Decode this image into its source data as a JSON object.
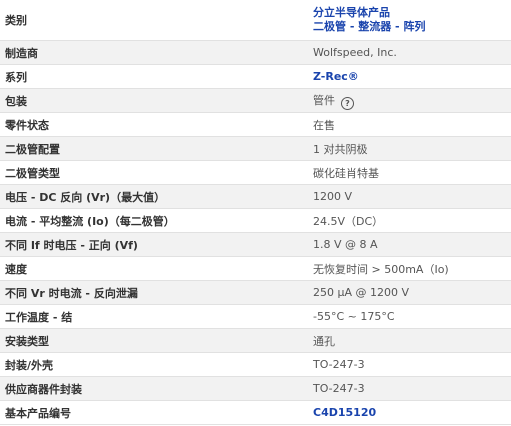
{
  "category": {
    "label": "类别",
    "link1": "分立半导体产品",
    "link2": "二极管 - 整流器 - 阵列"
  },
  "rows": [
    {
      "label": "制造商",
      "value": "Wolfspeed, Inc."
    },
    {
      "label": "系列",
      "value": "Z-Rec®"
    },
    {
      "label": "包装",
      "value": "管件"
    },
    {
      "label": "零件状态",
      "value": "在售"
    },
    {
      "label": "二极管配置",
      "value": "1 对共阴极"
    },
    {
      "label": "二极管类型",
      "value": "碳化硅肖特基"
    },
    {
      "label": "电压 - DC 反向 (Vr)（最大值）",
      "value": "1200 V"
    },
    {
      "label": "电流 - 平均整流 (Io)（每二极管）",
      "value": "24.5V（DC）"
    },
    {
      "label": "不同 If 时电压 - 正向 (Vf)",
      "value": "1.8 V @ 8 A"
    },
    {
      "label": "速度",
      "value": "无恢复时间 > 500mA（Io)"
    },
    {
      "label": "不同 Vr 时电流 - 反向泄漏",
      "value": "250 µA @ 1200 V"
    },
    {
      "label": "工作温度 - 结",
      "value": "-55°C ~ 175°C"
    },
    {
      "label": "安装类型",
      "value": "通孔"
    },
    {
      "label": "封装/外壳",
      "value": "TO-247-3"
    },
    {
      "label": "供应商器件封装",
      "value": "TO-247-3"
    },
    {
      "label": "基本产品编号",
      "value": "C4D15120"
    }
  ],
  "help_icon": "question-circle-icon",
  "colors": {
    "link": "#1a44ad",
    "alt_row": "#f2f2f2"
  }
}
